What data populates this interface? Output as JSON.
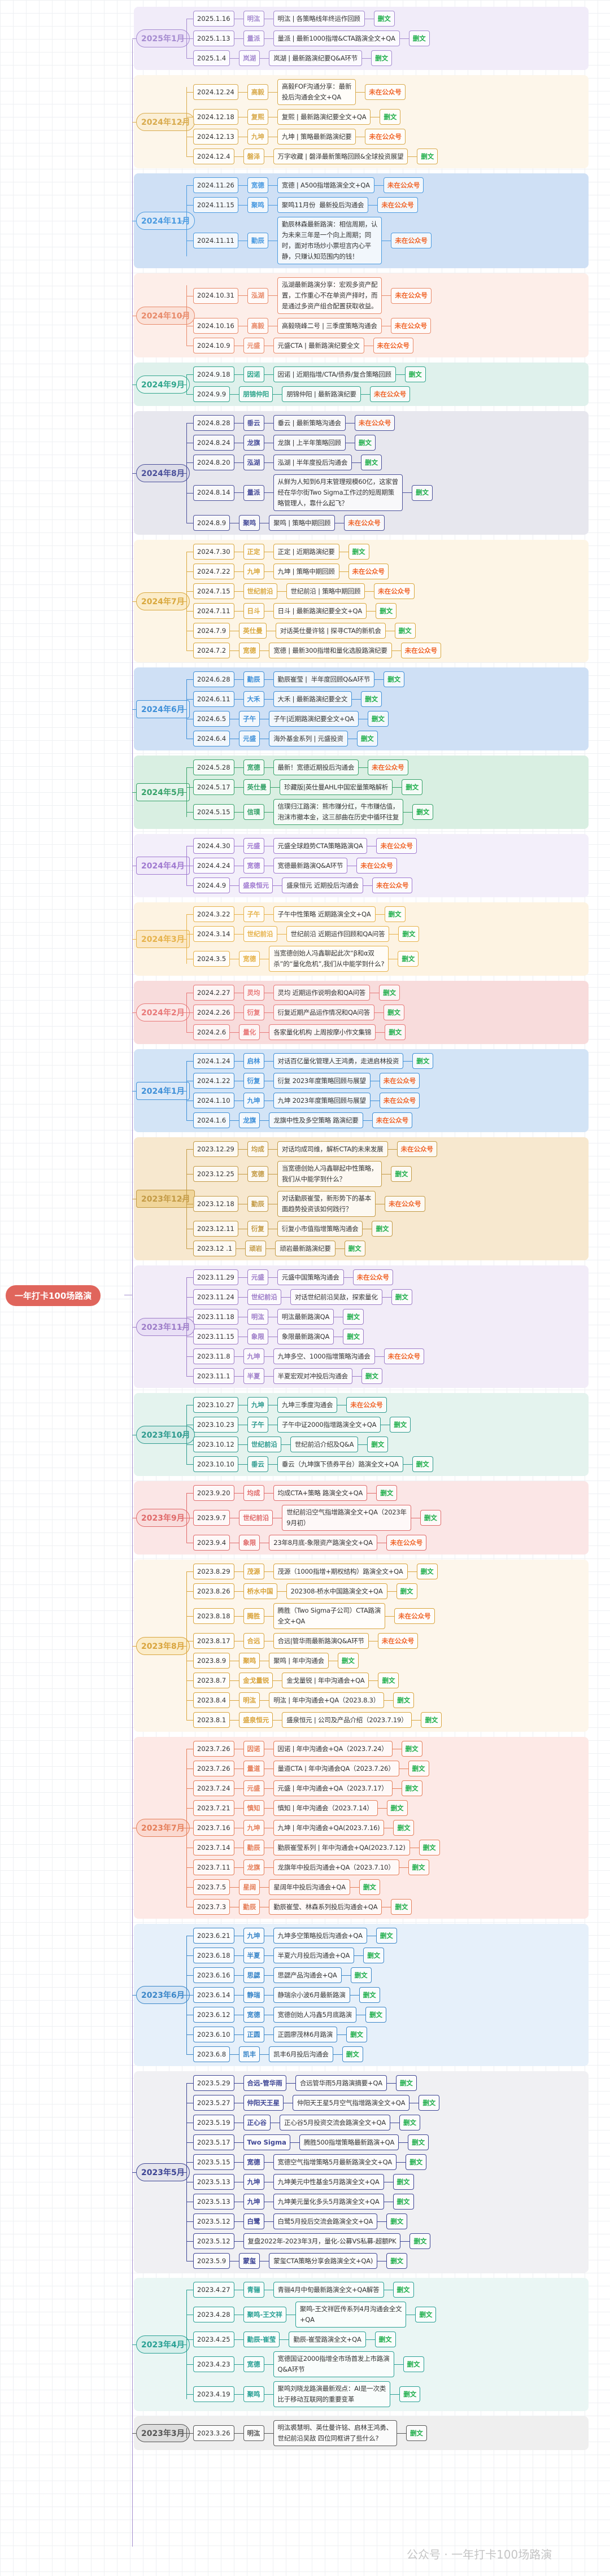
{
  "root": "一年打卡100场路演",
  "watermark": "公众号 · 一年打卡100场路演",
  "status_colors": {
    "删文": "#1fae4b",
    "未在公众号": "#f0652a"
  },
  "months": [
    {
      "label": "2025年1月",
      "accent": "#a58bd0",
      "panel": "#f1ecf9",
      "pill_bg": "#ece2f8",
      "entries": [
        {
          "date": "2025.1.16",
          "org": "明汯",
          "title": "明汯 | 各策略线年终运作回顾",
          "status": "删文"
        },
        {
          "date": "2025.1.13",
          "org": "量派",
          "title": "量派 | 最新1000指增&CTA路演全文+QA",
          "status": "删文"
        },
        {
          "date": "2025.1.4",
          "org": "岚湖",
          "title": "岚湖 | 最新路演纪要Q&A环节",
          "status": "删文"
        }
      ]
    },
    {
      "label": "2024年12月",
      "accent": "#d8aa4c",
      "panel": "#fdf6ea",
      "pill_bg": "#fbefd6",
      "entries": [
        {
          "date": "2024.12.24",
          "org": "高毅",
          "title": "高毅FOF沟通分享：最新\n投后沟通会全文+QA",
          "status": "未在公众号"
        },
        {
          "date": "2024.12.18",
          "org": "复熙",
          "title": "复熙 | 最新路演纪要全文+QA",
          "status": "删文"
        },
        {
          "date": "2024.12.13",
          "org": "九坤",
          "title": "九坤 | 策略最新路演纪要",
          "status": "未在公众号"
        },
        {
          "date": "2024.12.4",
          "org": "磐泽",
          "title": "万字收藏 | 磐泽最新策略回顾&全球投资展望",
          "status": "删文"
        }
      ]
    },
    {
      "label": "2024年11月",
      "accent": "#4a9ae0",
      "panel": "#cfe0f5",
      "pill_bg": "#dce9f8",
      "entries": [
        {
          "date": "2024.11.26",
          "org": "宽德",
          "title": "宽德 | A500指增路演全文+QA",
          "status": "未在公众号"
        },
        {
          "date": "2024.11.15",
          "org": "聚鸣",
          "title": "聚鸣11月份  最新投后沟通会",
          "status": "未在公众号"
        },
        {
          "date": "2024.11.11",
          "org": "勤辰",
          "title": "勤辰林森最新路演：相信周期，认\n为未来三年是一个向上周期；同\n时，面对市场炒小票坦言内心平\n静，只赚认知范围内的钱！",
          "status": "未在公众号"
        }
      ]
    },
    {
      "label": "2024年10月",
      "accent": "#e88a6a",
      "panel": "#fdeee9",
      "pill_bg": "#fbe2d9",
      "entries": [
        {
          "date": "2024.10.31",
          "org": "泓湖",
          "title": "泓湖最新路演分享：宏观多资产配\n置，工作重心不在单资产择时，而\n是通过多资产组合配置获取收益。",
          "status": "未在公众号"
        },
        {
          "date": "2024.10.16",
          "org": "高毅",
          "title": "高毅晓峰二号 | 三季度策略沟通会",
          "status": "未在公众号"
        },
        {
          "date": "2024.10.9",
          "org": "元盛",
          "title": "元盛CTA | 最新路演纪要全文",
          "status": "未在公众号"
        }
      ]
    },
    {
      "label": "2024年9月",
      "accent": "#2fa58c",
      "panel": "#dff1ec",
      "pill_bg": "#eaf7f3",
      "entries": [
        {
          "date": "2024.9.18",
          "org": "因诺",
          "title": "因诺 | 近期指增/CTA/债券/复合策略回顾",
          "status": "删文"
        },
        {
          "date": "2024.9.9",
          "org": "朋锦仲阳",
          "title": "朋锦仲阳 | 最新路演纪要",
          "status": "未在公众号"
        }
      ]
    },
    {
      "label": "2024年8月",
      "accent": "#4a4f9a",
      "panel": "#e7e7ee",
      "pill_bg": "#dcdce8",
      "entries": [
        {
          "date": "2024.8.28",
          "org": "垂云",
          "title": "垂云 | 最新策略沟通会",
          "status": "未在公众号"
        },
        {
          "date": "2024.8.24",
          "org": "龙旗",
          "title": "龙旗 | 上半年策略回顾",
          "status": "删文"
        },
        {
          "date": "2024.8.20",
          "org": "泓湖",
          "title": "泓湖 | 半年度投后沟通会",
          "status": "删文"
        },
        {
          "date": "2024.8.14",
          "org": "量派",
          "title": "从鲜为人知到6月末管理规模60亿，这家曾\n经在华尔街Two Sigma工作过的短周期策\n略管理人，靠什么起飞？",
          "status": "删文"
        },
        {
          "date": "2024.8.9",
          "org": "聚鸣",
          "title": "聚鸣 | 策略中期回顾",
          "status": "未在公众号"
        }
      ]
    },
    {
      "label": "2024年7月",
      "accent": "#d9a83e",
      "panel": "#fdf5e6",
      "pill_bg": "#fbecc9",
      "entries": [
        {
          "date": "2024.7.30",
          "org": "正定",
          "title": "正定 | 近期路演纪要",
          "status": "删文"
        },
        {
          "date": "2024.7.22",
          "org": "九坤",
          "title": "九坤 | 策略中期回顾",
          "status": "未在公众号"
        },
        {
          "date": "2024.7.15",
          "org": "世纪前沿",
          "title": "世纪前沿 | 策略中期回顾",
          "status": "未在公众号"
        },
        {
          "date": "2024.7.11",
          "org": "日斗",
          "title": "日斗 | 最新路演纪要全文+QA",
          "status": "删文"
        },
        {
          "date": "2024.7.9",
          "org": "英仕曼",
          "title": "对话英仕曼许铭 | 探寻CTA的新机会",
          "status": "删文"
        },
        {
          "date": "2024.7.2",
          "org": "宽德",
          "title": "宽德 | 最新300指增和量化选股路演纪要",
          "status": "未在公众号"
        }
      ]
    },
    {
      "label": "2024年6月",
      "accent": "#3e8fd8",
      "panel": "#cfe0f5",
      "pill_bg": "#dce9f8",
      "entries": [
        {
          "date": "2024.6.28",
          "org": "勤辰",
          "title": "勤辰崔莹 |  半年度回顾Q&A环节",
          "status": "删文"
        },
        {
          "date": "2024.6.11",
          "org": "大禾",
          "title": "大禾 | 最新路演纪要全文",
          "status": "删文"
        },
        {
          "date": "2024.6.5",
          "org": "子午",
          "title": "子午|近期路演纪要全文+QA",
          "status": "删文"
        },
        {
          "date": "2024.6.4",
          "org": "元盛",
          "title": "海外基金系列 | 元盛投资",
          "status": "删文"
        }
      ]
    },
    {
      "label": "2024年5月",
      "accent": "#37a26a",
      "panel": "#d9efe2",
      "pill_bg": "#e6f5ec",
      "entries": [
        {
          "date": "2024.5.28",
          "org": "宽德",
          "title": "最新！宽德近期投后沟通会",
          "status": "未在公众号"
        },
        {
          "date": "2024.5.17",
          "org": "英仕曼",
          "title": "珍藏版|英仕曼AHL中国宏量策略解析",
          "status": "删文"
        },
        {
          "date": "2024.5.15",
          "org": "信璞",
          "title": "信璞归江路演：熊市赚分红，牛市赚估值，\n泡沫市撤本金，这三部曲在历史中循环往复",
          "status": "删文"
        }
      ]
    },
    {
      "label": "2024年4月",
      "accent": "#a07ad0",
      "panel": "#f3effa",
      "pill_bg": "#f1eafa",
      "entries": [
        {
          "date": "2024.4.30",
          "org": "元盛",
          "title": "元盛全球趋势CTA策略路演QA",
          "status": "未在公众号"
        },
        {
          "date": "2024.4.24",
          "org": "宽德",
          "title": "宽德最新路演Q&A环节",
          "status": "未在公众号"
        },
        {
          "date": "2024.4.9",
          "org": "盛泉恒元",
          "title": "盛泉恒元 近期投后沟通会",
          "status": "未在公众号"
        }
      ]
    },
    {
      "label": "2024年3月",
      "accent": "#e6b24a",
      "panel": "#fdf3e2",
      "pill_bg": "#fbe8c6",
      "entries": [
        {
          "date": "2024.3.22",
          "org": "子午",
          "title": "子午中性策略 近期路演全文+QA",
          "status": "删文"
        },
        {
          "date": "2024.3.14",
          "org": "世纪前沿",
          "title": "世纪前沿 近期运作回顾和QA问答",
          "status": "删文"
        },
        {
          "date": "2024.3.5",
          "org": "宽德",
          "title": "当宽德创始人冯鑫聊起此次“β和α双\n杀”的“量化危机”,我们从中能学到什么?",
          "status": "删文"
        }
      ]
    },
    {
      "label": "2024年2月",
      "accent": "#e87878",
      "panel": "#f8dcdc",
      "pill_bg": "#fbe7e7",
      "entries": [
        {
          "date": "2024.2.27",
          "org": "灵均",
          "title": "灵均 近期运作说明会和QA问答",
          "status": "删文"
        },
        {
          "date": "2024.2.26",
          "org": "衍复",
          "title": "衍复近期产品运作情况和QA问答",
          "status": "删文"
        },
        {
          "date": "2024.2.6",
          "org": "量化",
          "title": "各家量化机构 上周按摩小作文集锦",
          "status": "删文"
        }
      ]
    },
    {
      "label": "2024年1月",
      "accent": "#3e8fd8",
      "panel": "#d3e4f6",
      "pill_bg": "#dce9f8",
      "entries": [
        {
          "date": "2024.1.24",
          "org": "启林",
          "title": "对话百亿量化管理人王鸿勇，走进启林投资",
          "status": "删文"
        },
        {
          "date": "2024.1.22",
          "org": "衍复",
          "title": "衍复 2023年度策略回顾与展望",
          "status": "未在公众号"
        },
        {
          "date": "2024.1.10",
          "org": "九坤",
          "title": "九坤 2023年度策略回顾与展望",
          "status": "未在公众号"
        },
        {
          "date": "2024.1.6",
          "org": "龙旗",
          "title": "龙旗中性及多空策略 路演纪要",
          "status": "未在公众号"
        }
      ]
    },
    {
      "label": "2023年12月",
      "accent": "#c39a45",
      "panel": "#f7e8cf",
      "pill_bg": "#f0d59a",
      "entries": [
        {
          "date": "2023.12.29",
          "org": "均成",
          "title": "对话均成司维，解析CTA的未来发展",
          "status": "未在公众号"
        },
        {
          "date": "2023.12.25",
          "org": "宽德",
          "title": "当宽德创始人冯鑫聊起中性策略，\n我们从中能学到什么？",
          "status": "删文"
        },
        {
          "date": "2023.12.18",
          "org": "勤辰",
          "title": "对话勤辰崔莹，新形势下的基本\n面趋势投资该如何践行？",
          "status": "未在公众号"
        },
        {
          "date": "2023.12.11",
          "org": "衍复",
          "title": "衍复小市值指增策略沟通会",
          "status": "删文"
        },
        {
          "date": "2023.12 .1",
          "org": "顽岩",
          "title": "顽岩最新路演纪要",
          "status": "删文"
        }
      ]
    },
    {
      "label": "2023年11月",
      "accent": "#9d7cc8",
      "panel": "#f2ecf8",
      "pill_bg": "#e9dff6",
      "entries": [
        {
          "date": "2023.11.29",
          "org": "元盛",
          "title": "元盛中国策略沟通会",
          "status": "未在公众号"
        },
        {
          "date": "2023.11.24",
          "org": "世纪前沿",
          "title": "对话世纪前沿吴敌，探索量化",
          "status": "删文"
        },
        {
          "date": "2023.11.18",
          "org": "明汯",
          "title": "明汯最新路演QA",
          "status": "删文"
        },
        {
          "date": "2023.11.15",
          "org": "象限",
          "title": "象限最新路演QA",
          "status": "删文"
        },
        {
          "date": "2023.11.8",
          "org": "九坤",
          "title": "九坤多空、1000指增策略沟通会",
          "status": "未在公众号"
        },
        {
          "date": "2023.11.1",
          "org": "半夏",
          "title": "半夏宏观对冲投后沟通会",
          "status": "删文"
        }
      ]
    },
    {
      "label": "2023年10月",
      "accent": "#2d9a8e",
      "panel": "#e4f3ee",
      "pill_bg": "#d4ece7",
      "entries": [
        {
          "date": "2023.10.27",
          "org": "九坤",
          "title": "九坤三季度沟通会",
          "status": "未在公众号"
        },
        {
          "date": "2023.10.23",
          "org": "子午",
          "title": "子午中证2000指增路演全文+QA",
          "status": "删文"
        },
        {
          "date": "2023.10.12",
          "org": "世纪前沿",
          "title": "世纪前沿介绍及Q&A",
          "status": "删文"
        },
        {
          "date": "2023.10.10",
          "org": "垂云",
          "title": "垂云（九坤旗下债券平台）路演全文+QA",
          "status": "删文"
        }
      ]
    },
    {
      "label": "2023年9月",
      "accent": "#e06a6a",
      "panel": "#fbe6e6",
      "pill_bg": "#f9dcdc",
      "entries": [
        {
          "date": "2023.9.20",
          "org": "均成",
          "title": "均成CTA+策略 路演全文+QA",
          "status": "删文"
        },
        {
          "date": "2023.9.7",
          "org": "世纪前沿",
          "title": "世纪前沿空气指增路演全文+QA（2023年\n9月初）",
          "status": "删文"
        },
        {
          "date": "2023.9.4",
          "org": "象限",
          "title": "23年8月底-象限资产路演全文+QA",
          "status": "未在公众号"
        }
      ]
    },
    {
      "label": "2023年8月",
      "accent": "#d9a43c",
      "panel": "#fdf6eb",
      "pill_bg": "#fbecc9",
      "entries": [
        {
          "date": "2023.8.29",
          "org": "茂源",
          "title": "茂源（1000指增+期权结构）路演全文+QA",
          "status": "删文"
        },
        {
          "date": "2023.8.26",
          "org": "桥水中国",
          "title": "202308-桥水中国路演全文+QA",
          "status": "删文"
        },
        {
          "date": "2023.8.18",
          "org": "腾胜",
          "title": "腾胜（Two Sigma子公司）CTA路演\n全文+QA",
          "status": "未在公众号"
        },
        {
          "date": "2023.8.17",
          "org": "合远",
          "title": "合远|管华雨最新路演Q&A环节",
          "status": "未在公众号"
        },
        {
          "date": "2023.8.9",
          "org": "聚鸣",
          "title": "聚鸣 | 年中沟通会",
          "status": "删文"
        },
        {
          "date": "2023.8.7",
          "org": "金戈量锐",
          "title": "金戈量锐 | 年中沟通会+QA",
          "status": "删文"
        },
        {
          "date": "2023.8.4",
          "org": "明汯",
          "title": "明汯 | 年中沟通会+QA（2023.8.3）",
          "status": "删文"
        },
        {
          "date": "2023.8.1",
          "org": "盛泉恒元",
          "title": "盛泉恒元 | 公司及产品介绍（2023.7.19）",
          "status": "删文"
        }
      ]
    },
    {
      "label": "2023年7月",
      "accent": "#e57f5a",
      "panel": "#fde9e6",
      "pill_bg": "#fbd9d0",
      "entries": [
        {
          "date": "2023.7.26",
          "org": "因诺",
          "title": "因诺 | 年中沟通会+QA（2023.7.24）",
          "status": "删文"
        },
        {
          "date": "2023.7.26",
          "org": "量道",
          "title": "量道CTA | 年中沟通会QA（2023.7.26）",
          "status": "删文"
        },
        {
          "date": "2023.7.24",
          "org": "元盛",
          "title": "元盛 | 年中沟通会+QA（2023.7.17）",
          "status": "删文"
        },
        {
          "date": "2023.7.21",
          "org": "慎知",
          "title": "慎知 | 年中沟通会（2023.7.14）",
          "status": "删文"
        },
        {
          "date": "2023.7.16",
          "org": "九坤",
          "title": "九坤 | 年中沟通会+QA(2023.7.16)",
          "status": "删文"
        },
        {
          "date": "2023.7.14",
          "org": "勤辰",
          "title": "勤辰崔莹系列 | 年中沟通会+QA(2023.7.12)",
          "status": "删文"
        },
        {
          "date": "2023.7.11",
          "org": "龙旗",
          "title": "龙旗年中投后沟通会+QA（2023.7.10）",
          "status": "删文"
        },
        {
          "date": "2023.7.5",
          "org": "星阔",
          "title": "星阔年中投后沟通会+QA",
          "status": "删文"
        },
        {
          "date": "2023.7.3",
          "org": "勤辰",
          "title": "勤辰崔莹、林森系列投后沟通会+QA",
          "status": "删文"
        }
      ]
    },
    {
      "label": "2023年6月",
      "accent": "#3a86c8",
      "panel": "#e6f0fa",
      "pill_bg": "#d6e6f6",
      "entries": [
        {
          "date": "2023.6.21",
          "org": "九坤",
          "title": "九坤多空策略投后沟通会+QA",
          "status": "删文"
        },
        {
          "date": "2023.6.18",
          "org": "半夏",
          "title": "半夏六月投后沟通会+QA",
          "status": "删文"
        },
        {
          "date": "2023.6.16",
          "org": "思勰",
          "title": "思勰产品沟通会+QA",
          "status": "删文"
        },
        {
          "date": "2023.6.14",
          "org": "静瑞",
          "title": "静瑞佘小波6月最新路演",
          "status": "删文"
        },
        {
          "date": "2023.6.12",
          "org": "宽德",
          "title": "宽德创始人冯鑫5月底路演",
          "status": "删文"
        },
        {
          "date": "2023.6.10",
          "org": "正圆",
          "title": "正圆廖茂林6月路演",
          "status": "删文"
        },
        {
          "date": "2023.6.8",
          "org": "凯丰",
          "title": "凯丰6月投后沟通会",
          "status": "删文"
        }
      ]
    },
    {
      "label": "2023年5月",
      "accent": "#3d4494",
      "panel": "#f0f0f3",
      "pill_bg": "#e4e4ec",
      "entries": [
        {
          "date": "2023.5.29",
          "org": "合远-管华雨",
          "title": "合远管华雨5月路演摘要+QA",
          "status": "删文"
        },
        {
          "date": "2023.5.27",
          "org": "仲阳天王星",
          "title": "仲阳天王星5月空气指增路演全文+QA",
          "status": "删文"
        },
        {
          "date": "2023.5.19",
          "org": "正心谷",
          "title": "正心谷5月投资交流会路演全文+QA",
          "status": "删文"
        },
        {
          "date": "2023.5.17",
          "org": "Two Sigma",
          "title": "腾胜500指增策略最新路演+QA",
          "status": "删文"
        },
        {
          "date": "2023.5.15",
          "org": "宽德",
          "title": "宽德空气指增策略5月最新路演全文+QA",
          "status": "删文"
        },
        {
          "date": "2023.5.13",
          "org": "九坤",
          "title": "九坤美元中性基金5月路演全文+QA",
          "status": "删文"
        },
        {
          "date": "2023.5.13",
          "org": "九坤",
          "title": "九坤美元量化多头5月路演全文+QA",
          "status": "删文"
        },
        {
          "date": "2023.5.12",
          "org": "白鹭",
          "title": "白鹭5月投后交流会路演全文+QA",
          "status": "删文"
        },
        {
          "date": "2023.5.12",
          "org": "",
          "title": "复盘2022年-2023年3月，量化-公募VS私募-超额PK",
          "status": "删文"
        },
        {
          "date": "2023.5.9",
          "org": "蒙玺",
          "title": "蒙玺CTA策略分享会路演全文+QA)",
          "status": "删文"
        }
      ]
    },
    {
      "label": "2023年4月",
      "accent": "#28a094",
      "panel": "#eaf6f4",
      "pill_bg": "#d6efeb",
      "entries": [
        {
          "date": "2023.4.27",
          "org": "青骊",
          "title": "青骊4月中旬最新路演全文+QA解答",
          "status": "删文"
        },
        {
          "date": "2023.4.28",
          "org": "聚鸣-王文祥",
          "title": "聚鸣-王文祥匠传系列4月沟通会全文\n+QA",
          "status": "删文"
        },
        {
          "date": "2023.4.25",
          "org": "勤辰-崔莹",
          "title": "勤辰-崔莹路演全文+QA",
          "status": "删文"
        },
        {
          "date": "2023.4.23",
          "org": "宽德",
          "title": "宽德国证2000指增全市场首发上市路演\nQ&A环节",
          "status": "删文"
        },
        {
          "date": "2023.4.19",
          "org": "聚鸣",
          "title": "聚鸣刘晓龙路演最新观点：AI是一次类\n比于移动互联网的重要变革",
          "status": "删文"
        }
      ]
    },
    {
      "label": "2023年3月",
      "accent": "#555555",
      "panel": "#efefef",
      "pill_bg": "#dddddd",
      "entries": [
        {
          "date": "2023.3.26",
          "org": "明汯",
          "title": "明汯裘慧明、英仕曼许铭、启林王鸿勇、\n世纪前沿吴敌 四位同框讲了些什么?",
          "status": "删文"
        }
      ]
    }
  ]
}
